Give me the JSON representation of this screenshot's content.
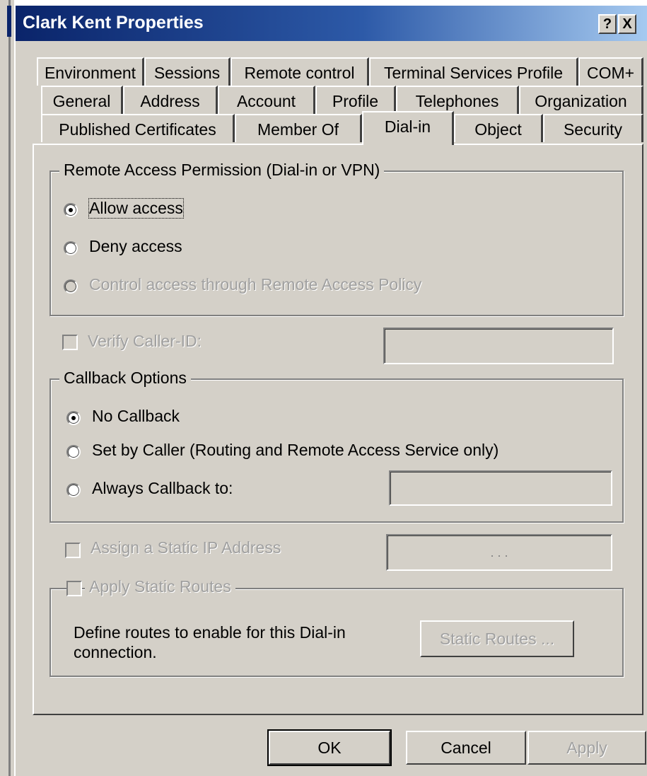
{
  "window": {
    "title": "Clark Kent Properties",
    "help_glyph": "?",
    "close_glyph": "X"
  },
  "tabs": {
    "row1": [
      "Environment",
      "Sessions",
      "Remote control",
      "Terminal Services Profile",
      "COM+"
    ],
    "row2": [
      "General",
      "Address",
      "Account",
      "Profile",
      "Telephones",
      "Organization"
    ],
    "row3": [
      "Published Certificates",
      "Member Of",
      "Dial-in",
      "Object",
      "Security"
    ],
    "active": "Dial-in"
  },
  "remote_access": {
    "legend": "Remote Access Permission (Dial-in or VPN)",
    "options": [
      {
        "label": "Allow access",
        "checked": true,
        "enabled": true
      },
      {
        "label": "Deny access",
        "checked": false,
        "enabled": true
      },
      {
        "label": "Control access through Remote Access Policy",
        "checked": false,
        "enabled": false
      }
    ]
  },
  "verify_caller_id": {
    "label": "Verify Caller-ID:",
    "checked": false,
    "enabled": false,
    "value": ""
  },
  "callback": {
    "legend": "Callback Options",
    "options": [
      {
        "label": "No Callback",
        "checked": true
      },
      {
        "label": "Set by Caller (Routing and Remote Access Service only)",
        "checked": false
      },
      {
        "label": "Always Callback to:",
        "checked": false
      }
    ],
    "callback_number": ""
  },
  "static_ip": {
    "label": "Assign a Static IP Address",
    "checked": false,
    "enabled": false,
    "value": ". . ."
  },
  "static_routes": {
    "label": "Apply Static Routes",
    "checked": false,
    "enabled": false,
    "description_line1": "Define routes to enable for this Dial-in",
    "description_line2": "connection.",
    "button_label": "Static Routes ..."
  },
  "footer": {
    "ok": "OK",
    "cancel": "Cancel",
    "apply": "Apply"
  }
}
